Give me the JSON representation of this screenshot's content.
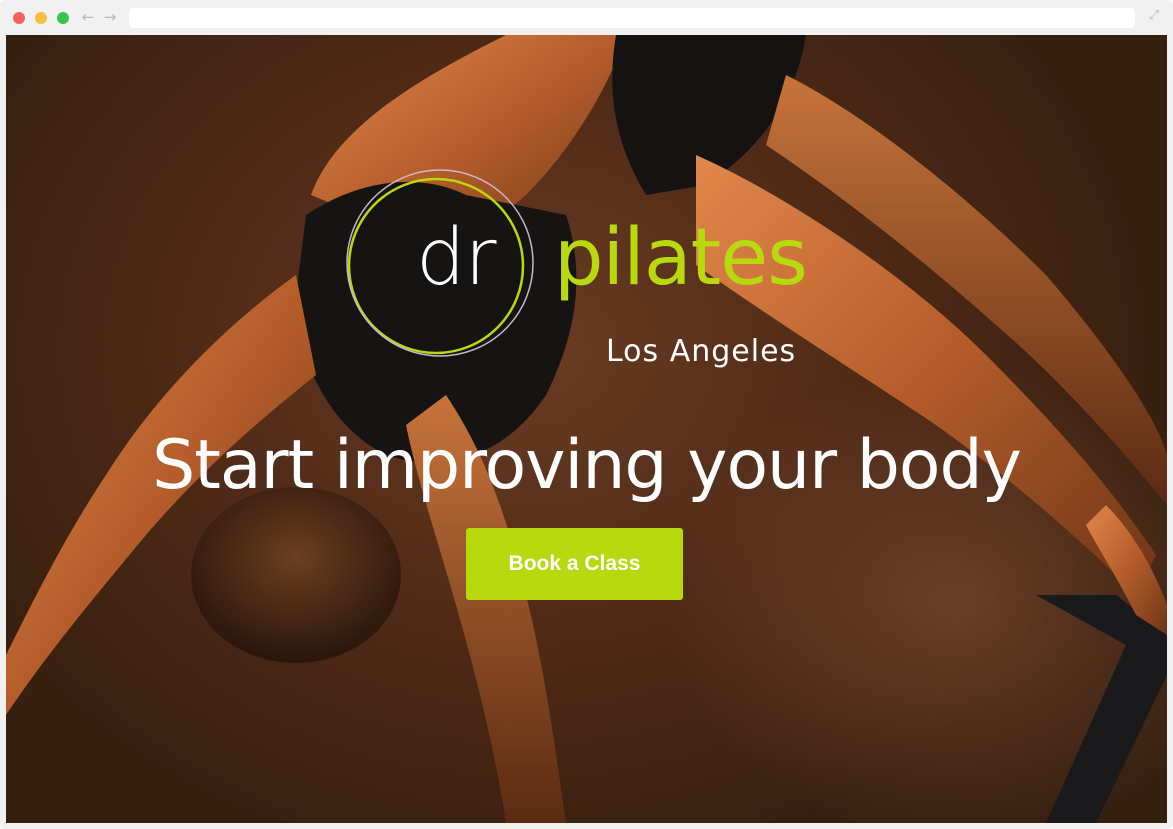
{
  "browser": {
    "url": "",
    "back_icon": "arrow-left-icon",
    "forward_icon": "arrow-right-icon",
    "expand_icon": "expand-icon"
  },
  "hero": {
    "logo": {
      "prefix": "dr",
      "name": "pilates",
      "location": "Los Angeles"
    },
    "headline": "Start improving your body",
    "cta_label": "Book a Class"
  },
  "colors": {
    "brand_green": "#b9d90f",
    "background_brown": "#4e2a17",
    "text_white": "#ffffff"
  }
}
